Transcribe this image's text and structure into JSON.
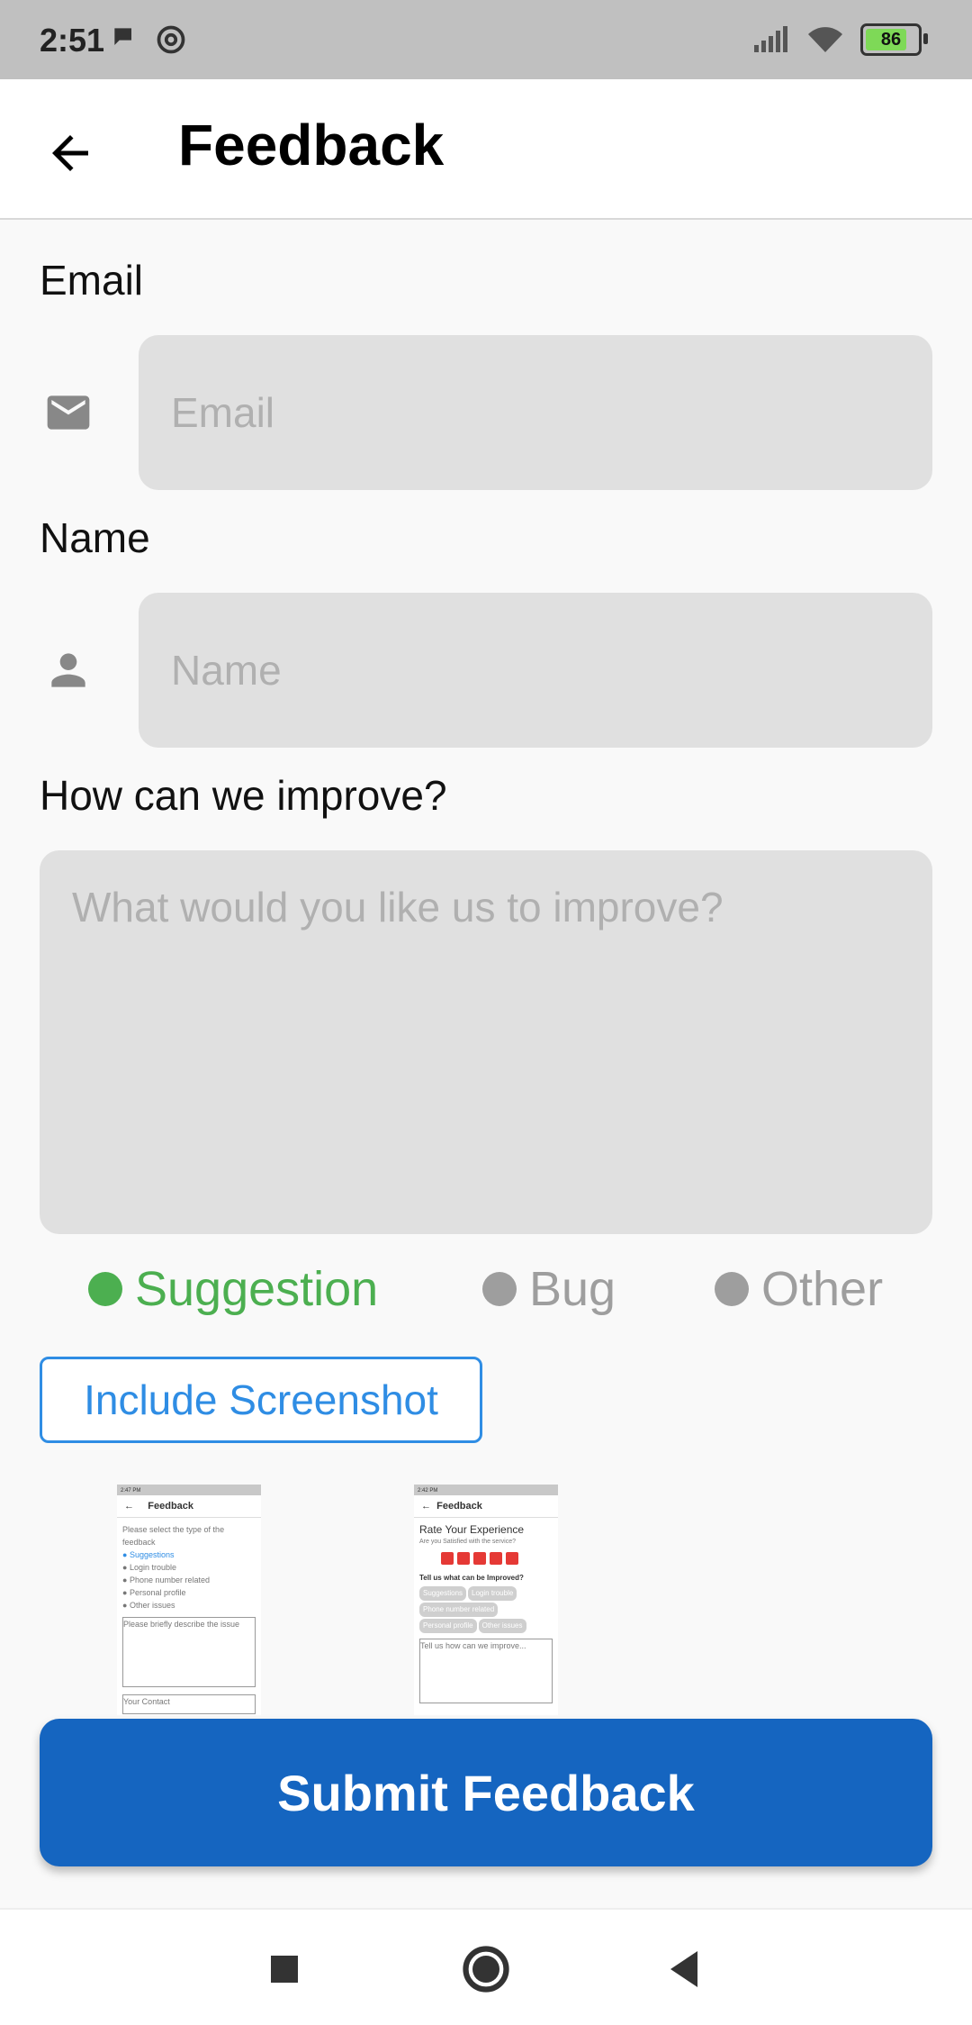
{
  "status_bar": {
    "time": "2:51",
    "battery": "86"
  },
  "app_bar": {
    "title": "Feedback"
  },
  "email": {
    "label": "Email",
    "placeholder": "Email"
  },
  "name": {
    "label": "Name",
    "placeholder": "Name"
  },
  "improve": {
    "label": "How can we improve?",
    "placeholder": "What would you like us to improve?"
  },
  "feedback_types": [
    {
      "label": "Suggestion",
      "selected": true
    },
    {
      "label": "Bug",
      "selected": false
    },
    {
      "label": "Other",
      "selected": false
    }
  ],
  "colors": {
    "selected": "#4caf50",
    "unselected": "#9e9e9e",
    "accent": "#2f8de4",
    "primary": "#1565c0"
  },
  "include_screenshot_label": "Include Screenshot",
  "thumbnails": [
    {
      "status_time": "2:47 PM",
      "title": "Feedback",
      "prompt": "Please select the type of the feedback",
      "options": [
        "Suggestions",
        "Login trouble",
        "Phone number related",
        "Personal profile",
        "Other issues"
      ],
      "box_placeholder": "Please briefly describe the issue",
      "box2_placeholder": "Your Contact"
    },
    {
      "status_time": "2:42 PM",
      "title": "Feedback",
      "heading": "Rate Your Experience",
      "subheading": "Are you Satisfied with the service?",
      "question": "Tell us what can be Improved?",
      "chips": [
        "Suggestions",
        "Login trouble",
        "Phone number related",
        "Personal profile",
        "Other issues"
      ],
      "box_placeholder": "Tell us how can we improve..."
    }
  ],
  "submit_label": "Submit Feedback"
}
